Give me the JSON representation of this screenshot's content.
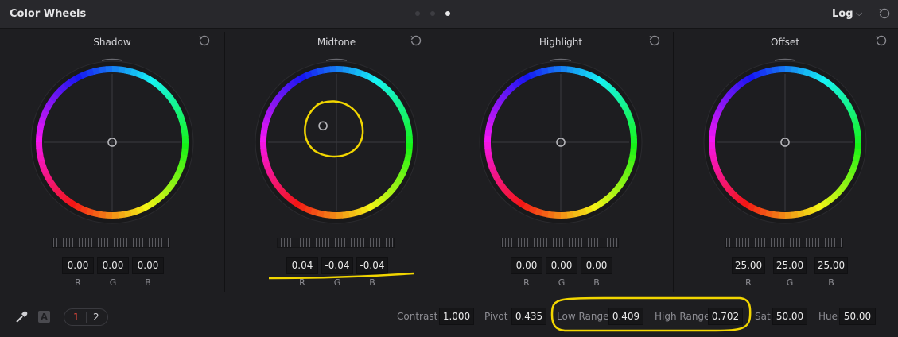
{
  "header": {
    "title": "Color Wheels",
    "mode": "Log",
    "mode_chevron": "chevron-down-icon",
    "reset_icon": "reset-all-icon",
    "page_dots": 3,
    "active_dot": 3
  },
  "wheels": [
    {
      "label": "Shadow",
      "values": [
        "0.00",
        "0.00",
        "0.00"
      ],
      "channels": [
        "R",
        "G",
        "B"
      ],
      "puck": [
        0,
        0
      ]
    },
    {
      "label": "Midtone",
      "values": [
        "0.04",
        "-0.04",
        "-0.04"
      ],
      "channels": [
        "R",
        "G",
        "B"
      ],
      "puck": [
        -0.22,
        -0.27
      ]
    },
    {
      "label": "Highlight",
      "values": [
        "0.00",
        "0.00",
        "0.00"
      ],
      "channels": [
        "R",
        "G",
        "B"
      ],
      "puck": [
        0,
        0
      ]
    },
    {
      "label": "Offset",
      "values": [
        "25.00",
        "25.00",
        "25.00"
      ],
      "channels": [
        "R",
        "G",
        "B"
      ],
      "puck": [
        0,
        0
      ]
    }
  ],
  "footer": {
    "picker_icon": "eyedropper-icon",
    "a_badge": "A",
    "page_1": "1",
    "page_2": "2",
    "contrast_label": "Contrast",
    "contrast_value": "1.000",
    "pivot_label": "Pivot",
    "pivot_value": "0.435",
    "low_range_label": "Low Range",
    "low_range_value": "0.409",
    "high_range_label": "High Range",
    "high_range_value": "0.702",
    "sat_label": "Sat",
    "sat_value": "50.00",
    "hue_label": "Hue",
    "hue_value": "50.00"
  },
  "colors": {
    "background": "#1e1e21",
    "header": "#28282c",
    "annotation": "#f2d600",
    "active_page": "#e0453a"
  }
}
